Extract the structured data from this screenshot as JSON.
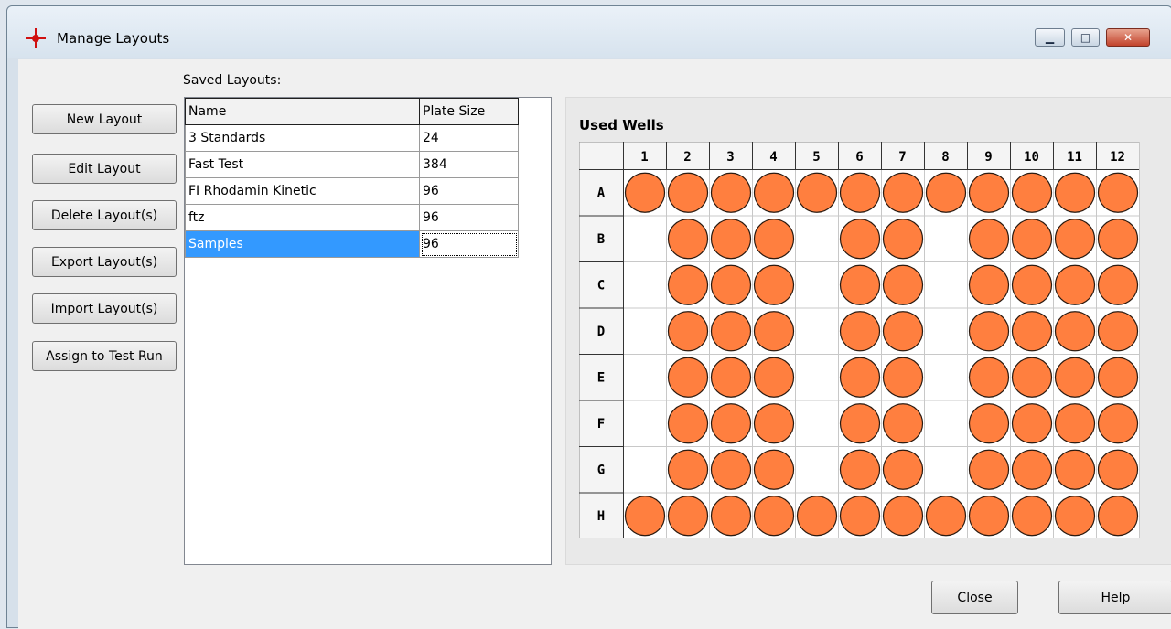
{
  "window": {
    "title": "Manage Layouts",
    "min_glyph": "▁",
    "max_glyph": "□",
    "close_glyph": "✕"
  },
  "saved_label": "Saved Layouts:",
  "buttons": {
    "new": "New Layout",
    "edit": "Edit Layout",
    "delete": "Delete Layout(s)",
    "export": "Export Layout(s)",
    "import": "Import Layout(s)",
    "assign": "Assign to Test Run",
    "close": "Close",
    "help": "Help"
  },
  "table": {
    "headers": {
      "name": "Name",
      "size": "Plate Size"
    },
    "rows": [
      {
        "name": "3 Standards",
        "size": "24"
      },
      {
        "name": "Fast Test",
        "size": "384"
      },
      {
        "name": "FI Rhodamin Kinetic",
        "size": "96"
      },
      {
        "name": "ftz",
        "size": "96"
      },
      {
        "name": "Samples",
        "size": "96",
        "selected": true
      }
    ]
  },
  "plate": {
    "title": "Used Wells",
    "columns": [
      "1",
      "2",
      "3",
      "4",
      "5",
      "6",
      "7",
      "8",
      "9",
      "10",
      "11",
      "12"
    ],
    "rows": [
      "A",
      "B",
      "C",
      "D",
      "E",
      "F",
      "G",
      "H"
    ],
    "used_color": "#ff7f3f",
    "used": {
      "A": [
        1,
        2,
        3,
        4,
        5,
        6,
        7,
        8,
        9,
        10,
        11,
        12
      ],
      "B": [
        2,
        3,
        4,
        6,
        7,
        9,
        10,
        11,
        12
      ],
      "C": [
        2,
        3,
        4,
        6,
        7,
        9,
        10,
        11,
        12
      ],
      "D": [
        2,
        3,
        4,
        6,
        7,
        9,
        10,
        11,
        12
      ],
      "E": [
        2,
        3,
        4,
        6,
        7,
        9,
        10,
        11,
        12
      ],
      "F": [
        2,
        3,
        4,
        6,
        7,
        9,
        10,
        11,
        12
      ],
      "G": [
        2,
        3,
        4,
        6,
        7,
        9,
        10,
        11,
        12
      ],
      "H": [
        1,
        2,
        3,
        4,
        5,
        6,
        7,
        8,
        9,
        10,
        11,
        12
      ]
    }
  }
}
